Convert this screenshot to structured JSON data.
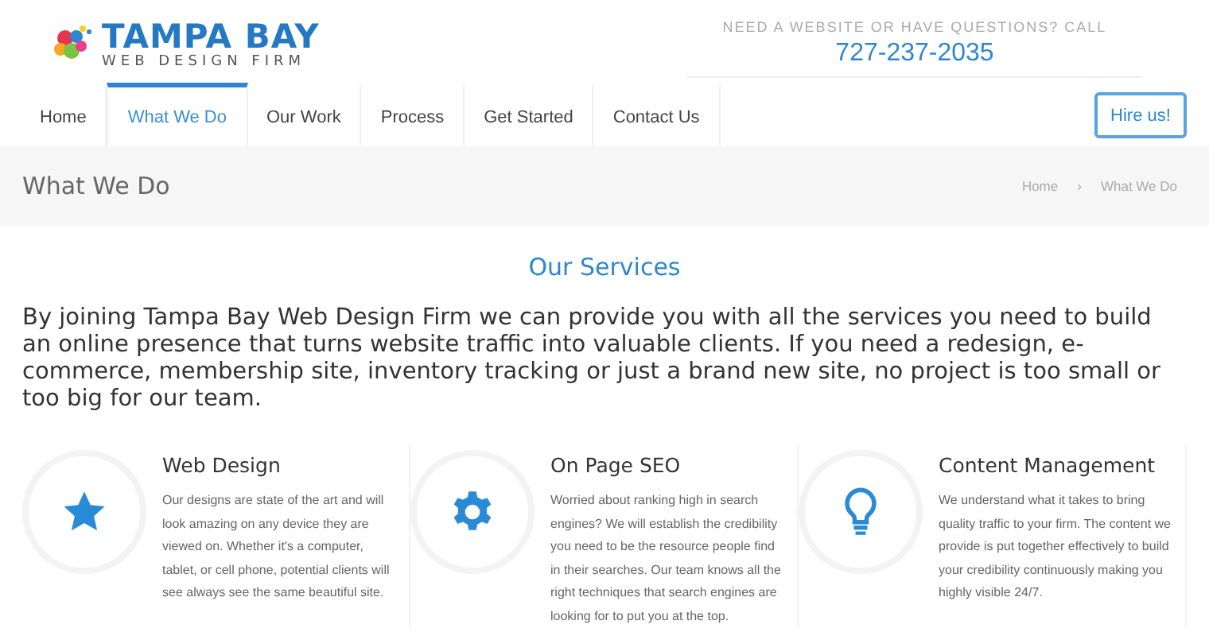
{
  "logo": {
    "title": "TAMPA BAY",
    "subtitle": "WEB DESIGN FIRM"
  },
  "contact": {
    "prompt": "NEED A WEBSITE OR HAVE QUESTIONS? CALL",
    "phone": "727-237-2035"
  },
  "nav": [
    {
      "label": "Home",
      "selected": false
    },
    {
      "label": "What We Do",
      "selected": true
    },
    {
      "label": "Our Work",
      "selected": false
    },
    {
      "label": "Process",
      "selected": false
    },
    {
      "label": "Get Started",
      "selected": false
    },
    {
      "label": "Contact Us",
      "selected": false
    }
  ],
  "cta": "Hire us!",
  "page_title": "What We Do",
  "breadcrumb": {
    "items": [
      "Home",
      "What We Do"
    ],
    "separator": "›"
  },
  "section_title": "Our Services",
  "intro": "By joining Tampa Bay Web Design Firm we can provide you with all the services you need to build an online presence that turns website traffic into valuable clients. If you need a redesign, e-commerce, membership site, inventory tracking or just a brand new site, no project is too small or too big for our team.",
  "services": [
    {
      "kind": "star",
      "title": "Web Design",
      "text": "Our designs are state of the art and will look amazing on any device they are viewed on. Whether it's a computer, tablet, or cell phone, potential clients will see always see the same beautiful site."
    },
    {
      "kind": "gear",
      "title": "On Page SEO",
      "text": "Worried about ranking high in search engines? We will establish the credibility you need to be the resource people find in their searches. Our team knows all the right techniques that search engines are looking for to put you at the top."
    },
    {
      "kind": "bulb",
      "title": "Content Management",
      "text": "We understand what it takes to bring quality traffic to your firm. The content we provide is put together effectively to build your credibility continuously making you highly visible 24/7."
    }
  ]
}
